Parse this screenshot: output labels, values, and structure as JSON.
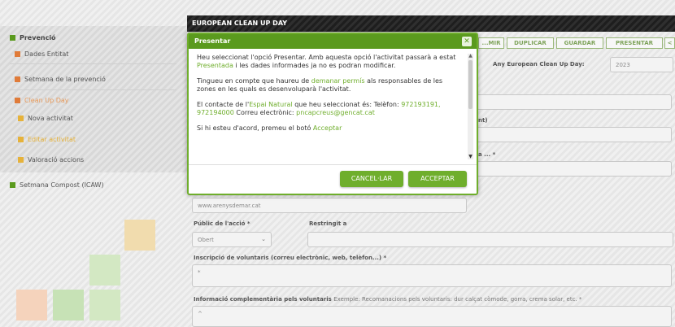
{
  "sidebar": {
    "items": [
      {
        "label": "Prevenció",
        "color": "#5a9a1e"
      },
      {
        "label": "Dades Entitat",
        "color": "#e07b39"
      },
      {
        "label": "Setmana de la prevenció",
        "color": "#e07b39"
      },
      {
        "label": "Clean Up Day",
        "color": "#e07b39"
      },
      {
        "label": "Nova activitat",
        "color": "#e6b23a"
      },
      {
        "label": "Editar activitat",
        "color": "#e6b23a"
      },
      {
        "label": "Valoració accions",
        "color": "#e6b23a"
      },
      {
        "label": "Setmana Compost (ICAW)",
        "color": "#5a9a1e"
      }
    ]
  },
  "header": {
    "title": "EUROPEAN CLEAN UP DAY"
  },
  "toolbar": {
    "buttons": [
      "...MIR",
      "DUPLICAR",
      "GUARDAR",
      "PRESENTAR",
      "<"
    ],
    "year_label": "Any European Clean Up Day:",
    "year_value": "2023"
  },
  "form": {
    "partial_label_1": "nt)",
    "partial_label_2": "a ... *",
    "web_value": "www.arenysdemar.cat",
    "public_label": "Públic de l'acció *",
    "public_value": "Obert",
    "restringit_label": "Restringit a",
    "inscripcio_label": "Inscripció de voluntaris (correu electrònic, web, telèfon...) *",
    "inscripcio_value": "*",
    "info_label": "Informació complementària pels voluntaris",
    "info_hint": "Exemple: Recomanacions pels voluntaris: dur calçat còmode, gorra, crema solar, etc. *",
    "info_value": "^"
  },
  "modal": {
    "title": "Presentar",
    "p1_a": "Heu seleccionat l'opció Presentar. Amb aquesta opció l'activitat passarà a estat ",
    "p1_link": "Presentada",
    "p1_b": " i les dades informades ja no es podran modificar.",
    "p2_a": "Tingueu en compte que haureu de ",
    "p2_link": "demanar permís",
    "p2_b": " als responsables de les zones en les quals es desenvoluparà l'activitat.",
    "p3_a": "El contacte de l'",
    "p3_link1": "Espai Natural",
    "p3_b": " que heu seleccionat és: Telèfon: ",
    "p3_link2": "972193191, 972194000",
    "p3_c": " Correu electrònic: ",
    "p3_link3": "pncapcreus@gencat.cat",
    "p4_a": "Si hi esteu d'acord, premeu el botó ",
    "p4_link": "Acceptar",
    "cancel_label": "CANCEL·LAR",
    "accept_label": "ACCEPTAR"
  }
}
